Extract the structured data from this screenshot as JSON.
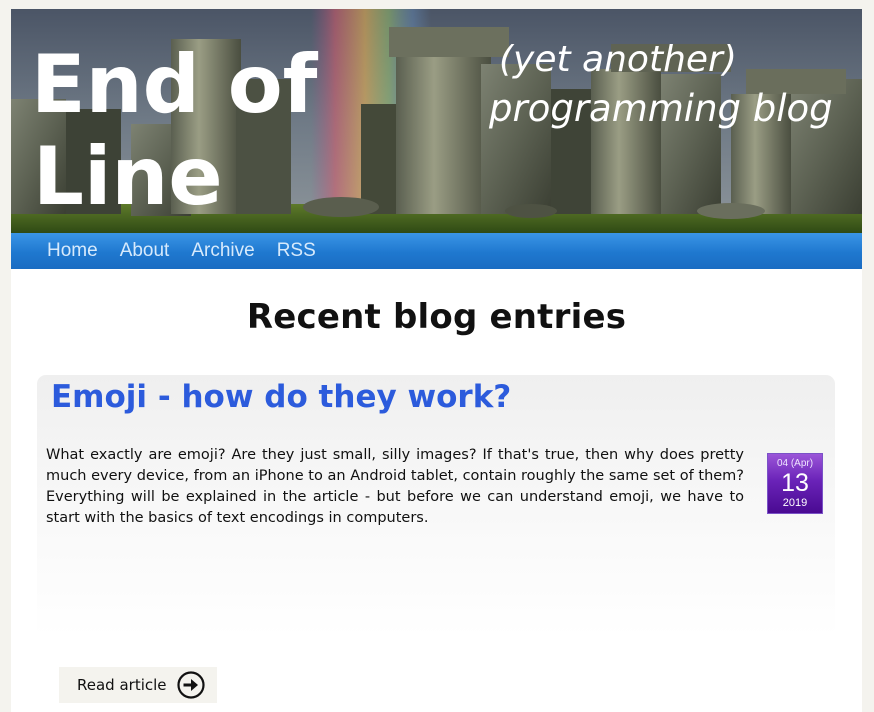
{
  "site": {
    "logo_title_line1": "End of",
    "logo_title_line2": "Line",
    "logo_tagline_line1": "(yet another)",
    "logo_tagline_line2": "programming blog"
  },
  "nav": {
    "items": [
      {
        "label": "Home"
      },
      {
        "label": "About"
      },
      {
        "label": "Archive"
      },
      {
        "label": "RSS"
      }
    ]
  },
  "main": {
    "heading": "Recent blog entries",
    "entries": [
      {
        "title": "Emoji - how do they work?",
        "excerpt": "What exactly are emoji? Are they just small, silly images? If that's true, then why does pretty much every device, from an iPhone to an Android tablet, contain roughly the same set of them? Everything will be explained in the article - but before we can understand emoji, we have to start with the basics of text encodings in computers.",
        "date": {
          "month": "04 (Apr)",
          "day": "13",
          "year": "2019"
        },
        "read_more_label": "Read article",
        "read_more_icon": "arrow-right-circle-icon"
      }
    ]
  },
  "colors": {
    "nav_bar": "#1f78cf",
    "entry_title": "#2c5bdc",
    "date_badge": "#6a23b8",
    "page_background": "#f4f3ee"
  }
}
